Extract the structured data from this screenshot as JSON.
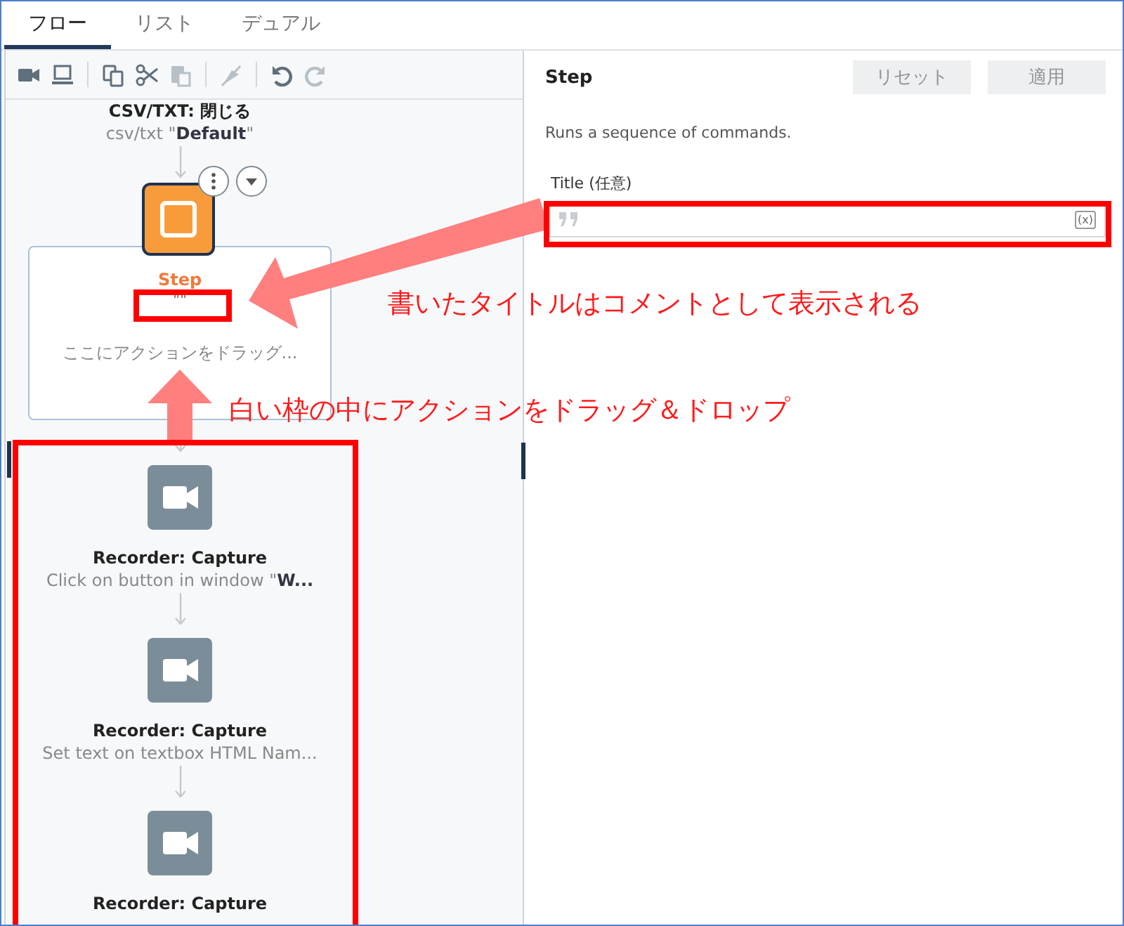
{
  "tabs": [
    {
      "label": "フロー",
      "selected": true
    },
    {
      "label": "リスト",
      "selected": false
    },
    {
      "label": "デュアル",
      "selected": false
    }
  ],
  "toolbar": [
    [
      {
        "kind": "camera",
        "disabled": false
      },
      {
        "kind": "monitor",
        "disabled": false
      }
    ],
    [
      {
        "kind": "copy",
        "disabled": false
      },
      {
        "kind": "cut",
        "disabled": false
      },
      {
        "kind": "paste",
        "disabled": true
      }
    ],
    [
      {
        "kind": "slash",
        "disabled": true
      }
    ],
    [
      {
        "kind": "undo",
        "disabled": false
      },
      {
        "kind": "redo",
        "disabled": true
      }
    ]
  ],
  "flow": [
    {
      "kind": "action",
      "title": "CSV/TXT: 閉じる",
      "subtitle": "csv/txt \"**Default**\""
    },
    {
      "kind": "step",
      "title": "Step",
      "comment": "\"\"",
      "hint": "ここにアクションをドラッグ...",
      "selected": true
    },
    {
      "kind": "recorder",
      "title": "Recorder: Capture",
      "subtitle": "Click on button in window \"**W...**",
      "selected": false
    },
    {
      "kind": "recorder",
      "title": "Recorder: Capture",
      "subtitle": "Set text on textbox HTML Nam...",
      "selected": false
    },
    {
      "kind": "recorder",
      "title": "Recorder: Capture",
      "selected": false
    }
  ],
  "details": {
    "title": "Step",
    "buttons": [
      {
        "label": "リセット",
        "disabled": true
      },
      {
        "label": "適用",
        "disabled": true
      }
    ],
    "description": "Runs a sequence of commands.",
    "field": {
      "label": "Title (任意)",
      "variable_button": "(x)"
    }
  },
  "annotations": [
    {
      "text": "書いたタイトルはコメントとして表示される"
    },
    {
      "text": "白い枠の中にアクションをドラッグ＆ドロップ"
    }
  ]
}
